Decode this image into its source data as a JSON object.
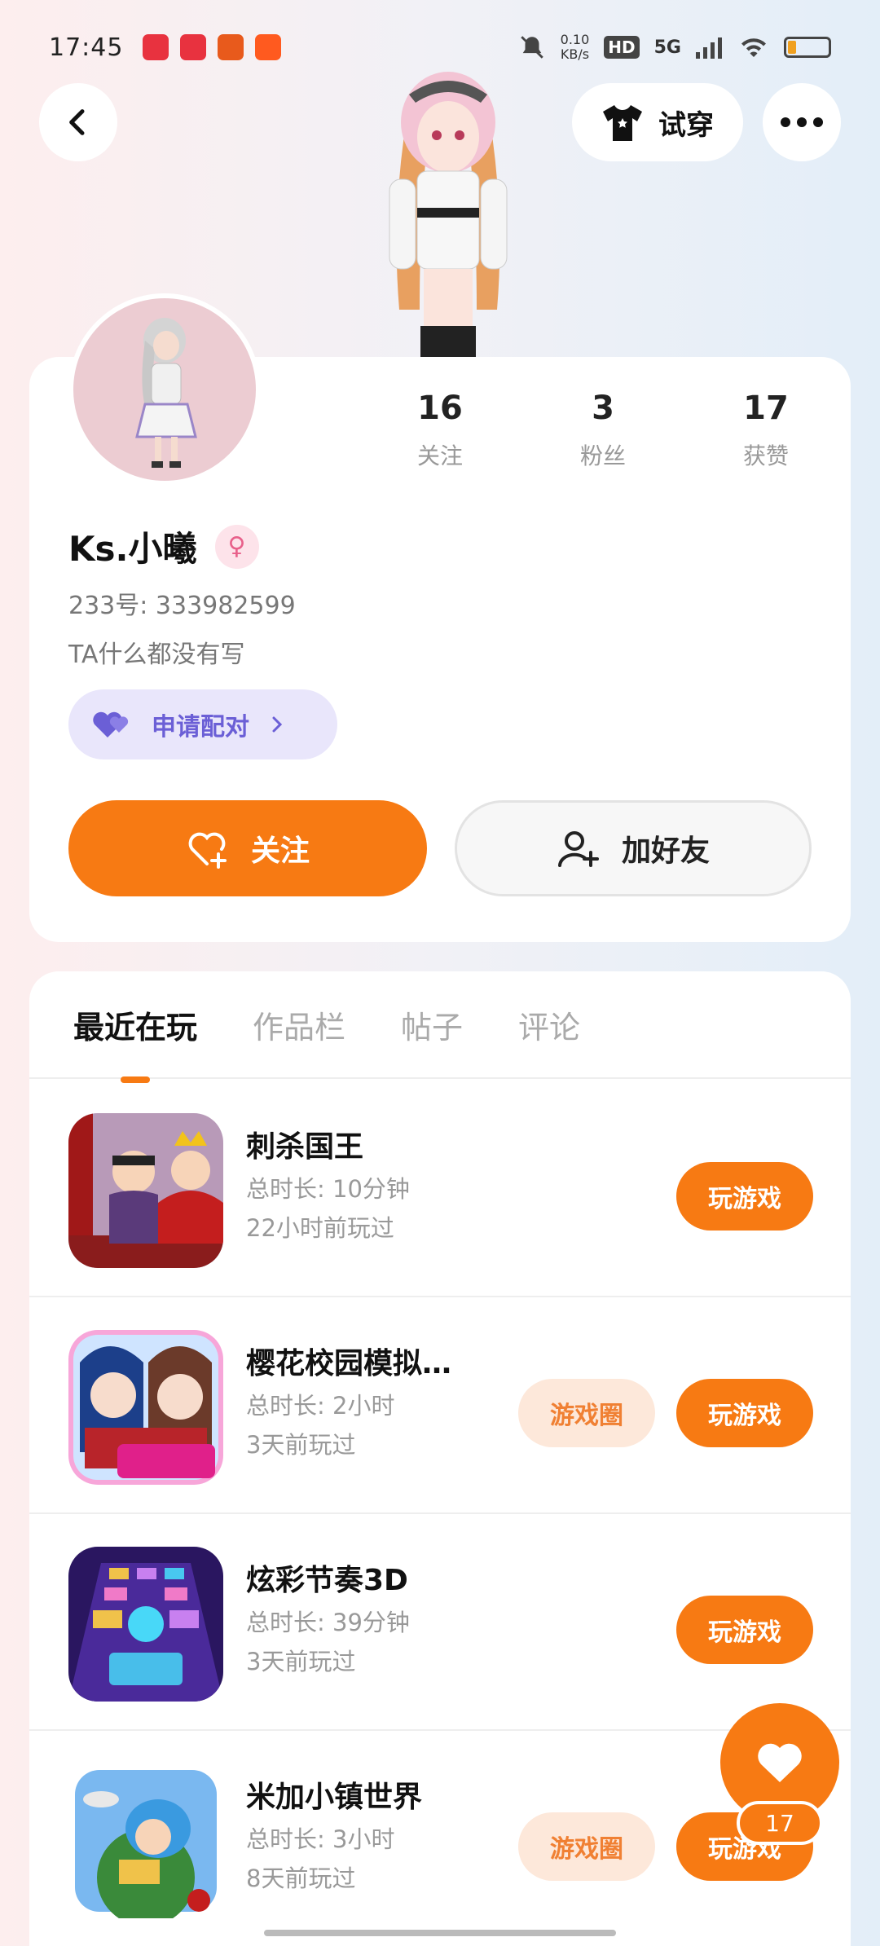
{
  "status_bar": {
    "time": "17:45",
    "network_speed": "0.10\nKB/s",
    "hd_label": "HD",
    "signal_label": "5G",
    "battery_percent": 20
  },
  "header": {
    "back_icon": "chevron-left-icon",
    "tryon_label": "试穿",
    "more_icon": "more-horizontal-icon"
  },
  "profile": {
    "nickname": "Ks.小曦",
    "gender_icon": "female-icon",
    "uid": "233号: 333982599",
    "bio": "TA什么都没有写",
    "pair_button_label": "申请配对",
    "stats": [
      {
        "value": "16",
        "label": "关注"
      },
      {
        "value": "3",
        "label": "粉丝"
      },
      {
        "value": "17",
        "label": "获赞"
      }
    ],
    "follow_label": "关注",
    "add_friend_label": "加好友"
  },
  "tabs": [
    {
      "label": "最近在玩",
      "active": true
    },
    {
      "label": "作品栏",
      "active": false
    },
    {
      "label": "帖子",
      "active": false
    },
    {
      "label": "评论",
      "active": false
    }
  ],
  "games": [
    {
      "title": "刺杀国王",
      "duration": "总时长: 10分钟",
      "last_played": "22小时前玩过",
      "visit_label": "玩游戏",
      "circle_label": ""
    },
    {
      "title": "樱花校园模拟…",
      "duration": "总时长: 2小时",
      "last_played": "3天前玩过",
      "visit_label": "玩游戏",
      "circle_label": "游戏圈"
    },
    {
      "title": "炫彩节奏3D",
      "duration": "总时长: 39分钟",
      "last_played": "3天前玩过",
      "visit_label": "玩游戏",
      "circle_label": ""
    },
    {
      "title": "米加小镇世界",
      "duration": "总时长: 3小时",
      "last_played": "8天前玩过",
      "visit_label": "玩游戏",
      "circle_label": "游戏圈"
    }
  ],
  "like_fab": {
    "count": "17",
    "icon": "heart-icon"
  },
  "colors": {
    "accent": "#f77a13",
    "pair": "#6b5fd6"
  }
}
